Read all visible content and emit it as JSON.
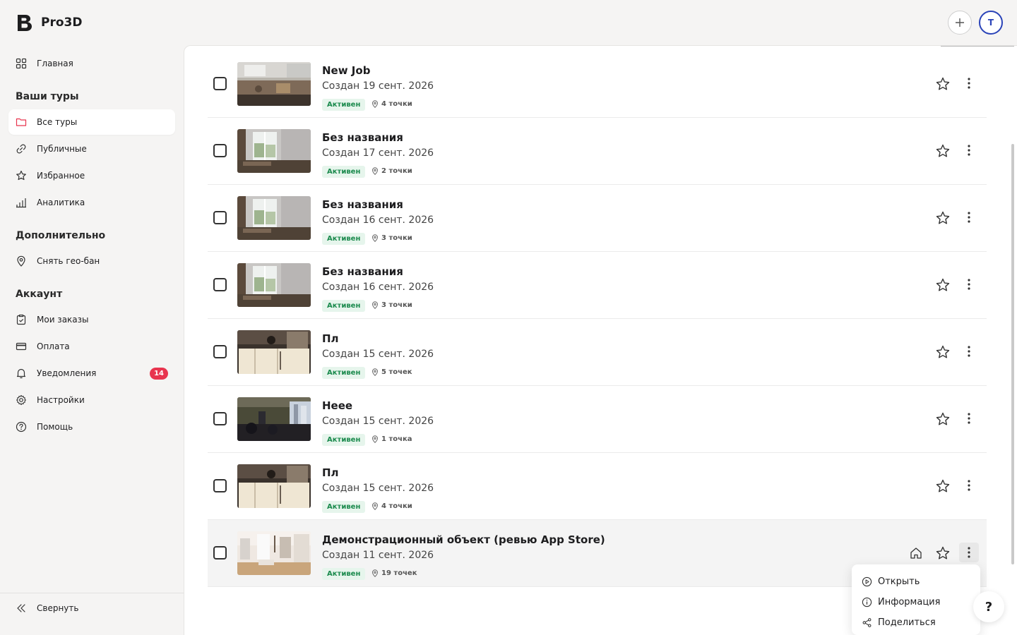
{
  "app": {
    "name": "Pro3D"
  },
  "header": {
    "add_label": "+",
    "avatar_initial": "T"
  },
  "sidebar": {
    "home": "Главная",
    "section_tours": "Ваши туры",
    "all_tours": "Все туры",
    "public": "Публичные",
    "favorites": "Избранное",
    "analytics": "Аналитика",
    "section_extra": "Дополнительно",
    "geo_ban": "Снять гео-бан",
    "section_account": "Аккаунт",
    "orders": "Мои заказы",
    "payment": "Оплата",
    "notifications": "Уведомления",
    "notifications_count": "14",
    "settings": "Настройки",
    "help": "Помощь",
    "collapse": "Свернуть"
  },
  "tours": [
    {
      "title": "New Job",
      "date": "Создан 19 сент. 2026",
      "status": "Активен",
      "points": "4 точки",
      "thumb": "kitchen"
    },
    {
      "title": "Без названия",
      "date": "Создан 17 сент. 2026",
      "status": "Активен",
      "points": "2 точки",
      "thumb": "window"
    },
    {
      "title": "Без названия",
      "date": "Создан 16 сент. 2026",
      "status": "Активен",
      "points": "3 точки",
      "thumb": "window"
    },
    {
      "title": "Без названия",
      "date": "Создан 16 сент. 2026",
      "status": "Активен",
      "points": "3 точки",
      "thumb": "window"
    },
    {
      "title": "Пл",
      "date": "Создан 15 сент. 2026",
      "status": "Активен",
      "points": "5 точек",
      "thumb": "cabinet"
    },
    {
      "title": "Неее",
      "date": "Создан 15 сент. 2026",
      "status": "Активен",
      "points": "1 точка",
      "thumb": "street"
    },
    {
      "title": "Пл",
      "date": "Создан 15 сент. 2026",
      "status": "Активен",
      "points": "4 точки",
      "thumb": "cabinet"
    },
    {
      "title": "Демонстрационный объект (ревью App Store)",
      "date": "Создан 11 сент. 2026",
      "status": "Активен",
      "points": "19 точек",
      "thumb": "interior"
    }
  ],
  "menu": {
    "open": "Открыть",
    "info": "Информация",
    "share": "Поделиться"
  },
  "help_button": "?",
  "colors": {
    "accent": "#2a43b8",
    "status_bg": "#e6f5ec",
    "status_text": "#1b8a4d",
    "badge": "#e8344e"
  }
}
